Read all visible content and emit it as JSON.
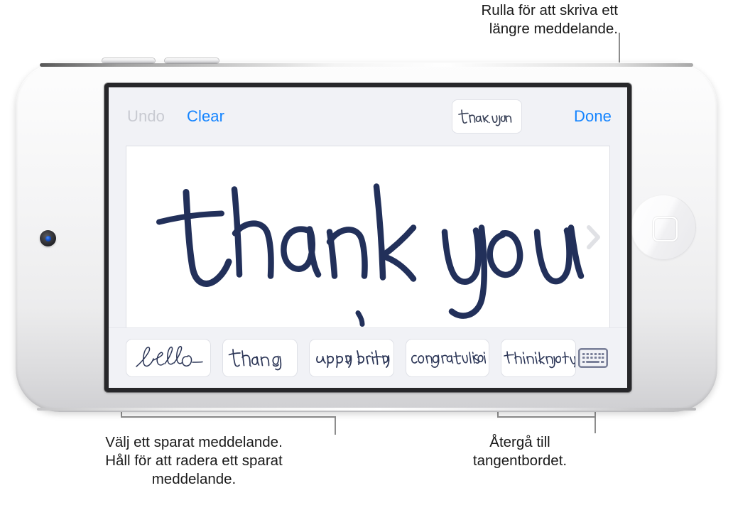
{
  "callouts": {
    "top": "Rulla för att skriva ett\nlängre meddelande.",
    "bottom_left": "Välj ett sparat meddelande.\nHåll för att radera ett sparat\nmeddelande.",
    "bottom_right": "Återgå till\ntangentbordet."
  },
  "screen": {
    "toolbar": {
      "undo_label": "Undo",
      "clear_label": "Clear",
      "done_label": "Done",
      "saved_chip_text": "thank you"
    },
    "canvas": {
      "handwriting_text": "thank you",
      "scroll_chevron_icon": "chevron-right-icon",
      "ink_color": "#22305a"
    },
    "suggestions": {
      "items": [
        {
          "text": "hello",
          "style": "script"
        },
        {
          "text": "thank you",
          "style": "print"
        },
        {
          "text": "happy birthday",
          "style": "slant"
        },
        {
          "text": "congratulations",
          "style": "print"
        },
        {
          "text": "thinking of you",
          "style": "print"
        }
      ],
      "keyboard_button_icon": "keyboard-icon"
    }
  },
  "device": {
    "camera_icon": "front-camera",
    "home_button_icon": "home-button",
    "volume_up_icon": "volume-up-button",
    "volume_down_icon": "volume-down-button"
  },
  "colors": {
    "accent_blue": "#1484ff",
    "disabled_gray": "#c8cad1",
    "ink_navy": "#22305a",
    "screen_bg": "#f1f2f6",
    "callout_line": "#8d8d8d"
  }
}
